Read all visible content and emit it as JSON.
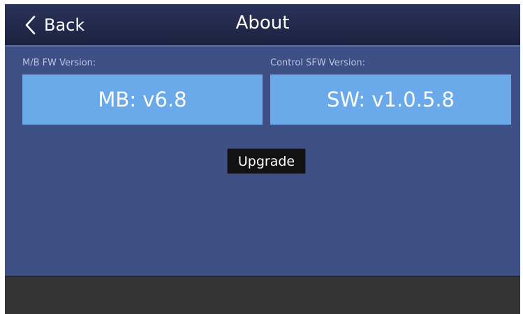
{
  "header": {
    "back_label": "Back",
    "title": "About",
    "back_icon": "chevron-left-icon"
  },
  "versions": {
    "mb_label": "M/B FW Version:",
    "mb_value": "MB: v6.8",
    "sw_label": "Control SFW Version:",
    "sw_value": "SW: v1.0.5.8"
  },
  "actions": {
    "upgrade_label": "Upgrade"
  },
  "colors": {
    "background": "#3d4f84",
    "header": "#1c2140",
    "version_box": "#6aaaea",
    "button": "#121212",
    "footer": "#333333"
  }
}
